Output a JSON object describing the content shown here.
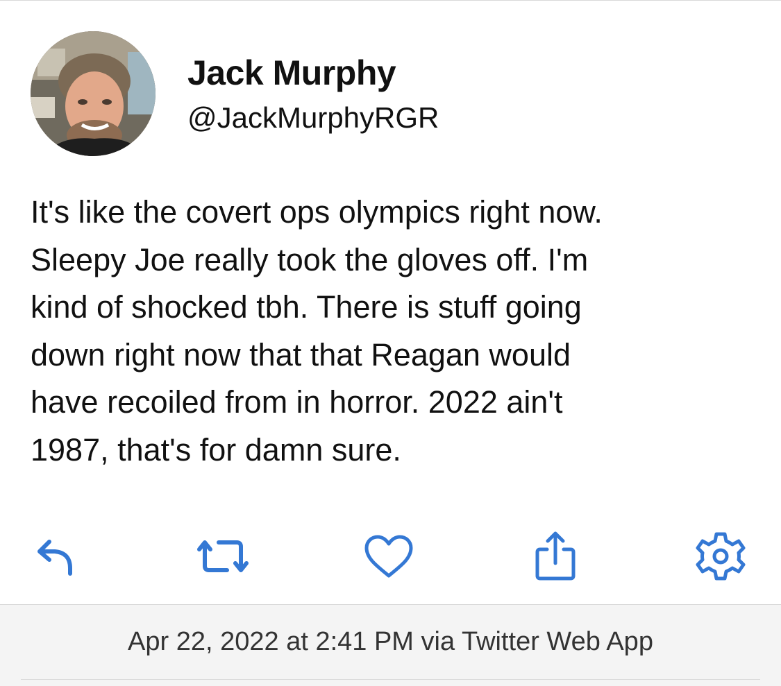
{
  "author": {
    "display_name": "Jack Murphy",
    "handle": "@JackMurphyRGR"
  },
  "tweet": {
    "lines": [
      "It's like the covert ops olympics right now.",
      "Sleepy Joe really took the gloves off. I'm",
      "kind of shocked tbh. There is stuff going",
      "down right now that that Reagan would",
      "have recoiled from in horror. 2022 ain't",
      "1987, that's for damn sure."
    ]
  },
  "actions": {
    "icons": [
      "reply-icon",
      "retweet-icon",
      "heart-icon",
      "share-icon",
      "gear-icon"
    ],
    "accent_color": "#3478d4"
  },
  "footer": {
    "timestamp_line": "Apr 22, 2022 at 2:41 PM via Twitter Web App"
  }
}
